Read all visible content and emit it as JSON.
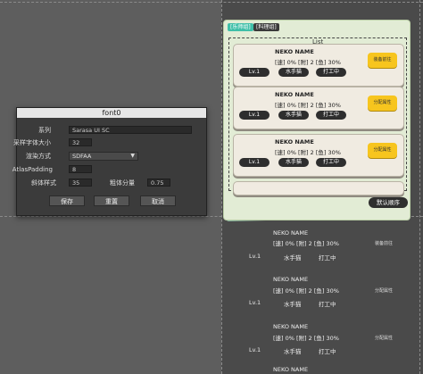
{
  "dialog": {
    "title": "font0",
    "rows": [
      {
        "label": "系列",
        "value": "Sarasa UI SC"
      },
      {
        "label": "采样字体大小",
        "value": "32"
      },
      {
        "label": "渲染方式",
        "value": "SDFAA"
      },
      {
        "label": "AtlasPadding",
        "value": "8"
      },
      {
        "label": "斜体样式",
        "value": "35",
        "extra_label": "粗体分量",
        "extra_value": "0.75"
      }
    ],
    "buttons": {
      "save": "保存",
      "reset": "重置",
      "cancel": "取消"
    }
  },
  "panel": {
    "tabs": [
      "[乐师组]",
      "[料理组]"
    ],
    "list_label": "List",
    "cards": [
      {
        "name": "NEKO NAME",
        "stats": "[速] 0% [附] 2 [鱼] 30%",
        "level": "Lv.1",
        "role": "水手猫",
        "status": "打工中",
        "action": "装备前往"
      },
      {
        "name": "NEKO NAME",
        "stats": "[速] 0% [附] 2 [鱼] 30%",
        "level": "Lv.1",
        "role": "水手猫",
        "status": "打工中",
        "action": "分配属性"
      },
      {
        "name": "NEKO NAME",
        "stats": "[速] 0% [附] 2 [鱼] 30%",
        "level": "Lv.1",
        "role": "水手猫",
        "status": "打工中",
        "action": "分配属性"
      }
    ],
    "sort_button": "默认顺序"
  },
  "overflow": [
    {
      "name": "NEKO NAME",
      "stats": "[速] 0% [附] 2 [鱼] 30%",
      "level": "Lv.1",
      "role": "水手猫",
      "status": "打工中",
      "action": "装备前往"
    },
    {
      "name": "NEKO NAME",
      "stats": "[速] 0% [附] 2 [鱼] 30%",
      "level": "Lv.1",
      "role": "水手猫",
      "status": "打工中",
      "action": "分配属性"
    },
    {
      "name": "NEKO NAME",
      "stats": "[速] 0% [附] 2 [鱼] 30%",
      "level": "Lv.1",
      "role": "水手猫",
      "status": "打工中",
      "action": "分配属性"
    },
    {
      "name": "NEKO NAME"
    }
  ]
}
